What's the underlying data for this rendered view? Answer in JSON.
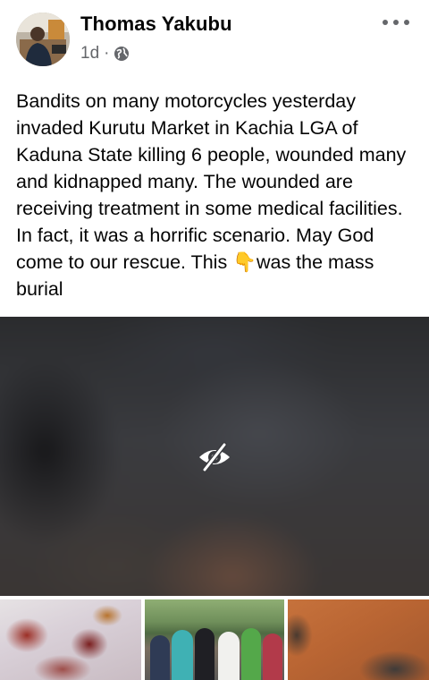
{
  "post": {
    "author": "Thomas Yakubu",
    "time": "1d",
    "separator": "·",
    "privacy_icon": "globe-icon",
    "more_icon": "more-horizontal-icon",
    "text_before_emoji": "Bandits on many motorcycles yesterday invaded Kurutu Market in Kachia LGA of Kaduna State killing 6 people, wounded many and kidnapped many. The wounded are receiving treatment in some medical facilities. In fact, it was a horrific scenario. May God come to our rescue. This ",
    "emoji": "👇",
    "text_after_emoji": "was the mass burial"
  },
  "media": {
    "main_overlay_icon": "eye-slash-icon",
    "thumbnails": [
      "thumbnail-1",
      "thumbnail-2",
      "thumbnail-3"
    ]
  },
  "colors": {
    "text": "#050505",
    "secondary": "#65676b",
    "background": "#ffffff"
  }
}
